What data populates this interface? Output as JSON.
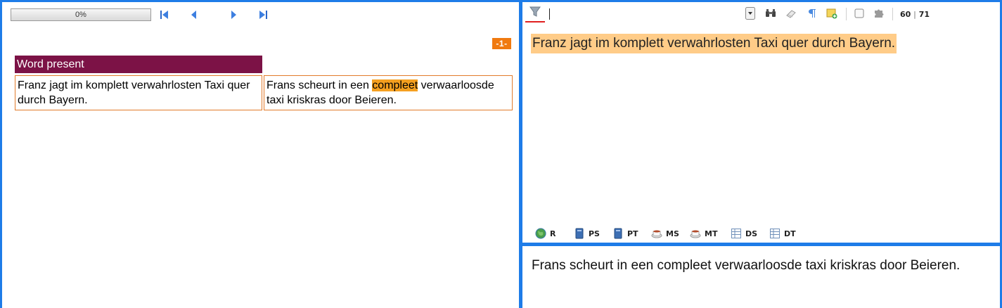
{
  "left": {
    "progress_text": "0%",
    "nav": {
      "first": "first-page-icon",
      "prev": "previous-page-icon",
      "next": "next-page-icon",
      "last": "last-page-icon"
    },
    "page_tag": "-1-",
    "match": {
      "header": "Word present",
      "source_text": "Franz jagt im komplett verwahrlosten Taxi quer durch Bayern.",
      "target_before": "Frans scheurt in een ",
      "target_highlight": "compleet",
      "target_after": " verwaarloosde taxi kriskras door Beieren."
    }
  },
  "right": {
    "toolbar": {
      "filter_icon": "filter-icon",
      "counter_current": "60",
      "counter_sep": "|",
      "counter_total": "71"
    },
    "source_segment": "Franz jagt im komplett verwahrlosten Taxi quer durch Bayern.",
    "tabs": [
      {
        "label": "R",
        "icon": "globe-icon"
      },
      {
        "label": "PS",
        "icon": "book-icon"
      },
      {
        "label": "PT",
        "icon": "book-icon"
      },
      {
        "label": "MS",
        "icon": "cup-icon"
      },
      {
        "label": "MT",
        "icon": "cup-icon"
      },
      {
        "label": "DS",
        "icon": "table-icon"
      },
      {
        "label": "DT",
        "icon": "table-icon"
      }
    ],
    "target_segment": "Frans scheurt in een compleet verwaarloosde taxi kriskras door Beieren."
  },
  "colors": {
    "accent_border": "#1e7ce8",
    "match_header": "#7c1246",
    "highlight": "#f5a020",
    "segment_bg": "#ffcc88",
    "page_tag": "#f07a10"
  }
}
